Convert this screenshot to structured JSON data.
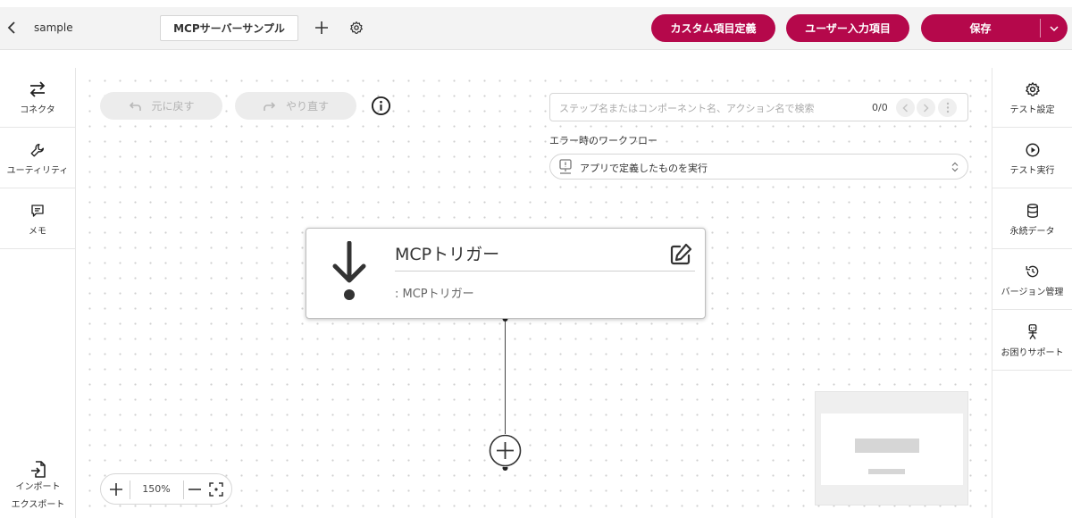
{
  "header": {
    "app_name": "sample",
    "active_tab": "MCPサーバーサンプル",
    "custom_fields_button": "カスタム項目定義",
    "user_input_button": "ユーザー入力項目",
    "save_button": "保存",
    "accent_color": "#b5084b"
  },
  "left_sidebar": {
    "items": [
      {
        "label": "コネクタ",
        "icon": "arrows-exchange-icon"
      },
      {
        "label": "ユーティリティ",
        "icon": "wrench-icon"
      },
      {
        "label": "メモ",
        "icon": "memo-icon"
      }
    ],
    "import_label": "インポート",
    "export_label": "エクスポート"
  },
  "right_sidebar": {
    "items": [
      {
        "label": "テスト設定",
        "icon": "gear-icon"
      },
      {
        "label": "テスト実行",
        "icon": "play-circle-icon"
      },
      {
        "label": "永続データ",
        "icon": "database-icon"
      },
      {
        "label": "バージョン管理",
        "icon": "history-icon"
      },
      {
        "label": "お困りサポート",
        "icon": "support-icon"
      }
    ]
  },
  "canvas": {
    "undo_label": "元に戻す",
    "redo_label": "やり直す",
    "search": {
      "placeholder": "ステップ名またはコンポーネント名、アクション名で検索",
      "count": "0/0"
    },
    "error_workflow": {
      "label": "エラー時のワークフロー",
      "value": "アプリで定義したものを実行"
    },
    "node": {
      "title": "MCPトリガー",
      "subtitle": ": MCPトリガー",
      "icon": "arrow-down-icon"
    },
    "zoom": "150%"
  }
}
